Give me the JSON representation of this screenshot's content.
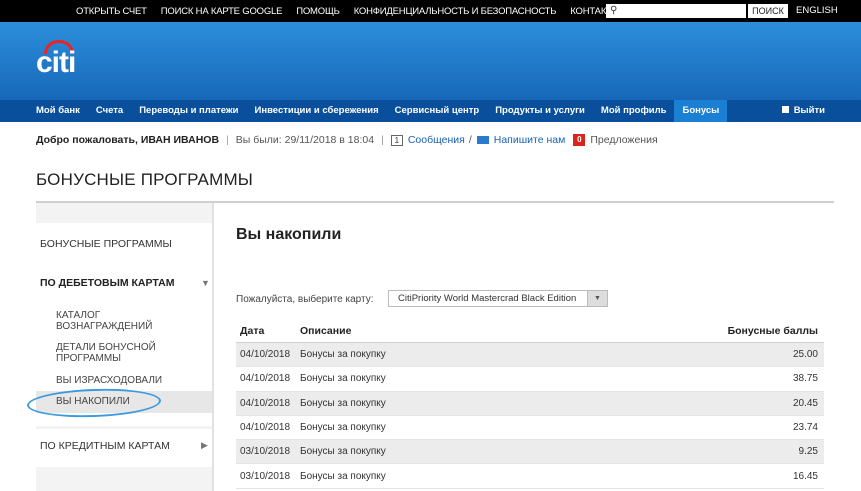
{
  "topbar": {
    "links": [
      "ОТКРЫТЬ СЧЕТ",
      "ПОИСК НА КАРТЕ GOOGLE",
      "ПОМОЩЬ",
      "КОНФИДЕНЦИАЛЬНОСТЬ И БЕЗОПАСНОСТЬ",
      "КОНТАКТЫ"
    ],
    "search_value": "",
    "search_button": "ПОИСК",
    "language": "ENGLISH"
  },
  "logo": {
    "text": "citi",
    "arc_color": "#e22222"
  },
  "nav": {
    "items": [
      "Мой банк",
      "Счета",
      "Переводы и платежи",
      "Инвестиции и сбережения",
      "Сервисный центр",
      "Продукты и услуги",
      "Мой профиль",
      "Бонусы"
    ],
    "active": "Бонусы",
    "logout": "Выйти"
  },
  "welcome": {
    "greeting": "Добро пожаловать, ИВАН ИВАНОВ",
    "separator": "|",
    "last_visit": "Вы были: 29/11/2018 в 18:04",
    "messages_count": "1",
    "messages": "Сообщения",
    "slash": "/",
    "write_us": "Напишите нам",
    "offers_count": "0",
    "offers": "Предложения"
  },
  "page": {
    "title": "БОНУСНЫЕ ПРОГРАММЫ"
  },
  "sidebar": {
    "programs": "БОНУСНЫЕ ПРОГРАММЫ",
    "debit": "ПО ДЕБЕТОВЫМ КАРТАМ",
    "sub": [
      "КАТАЛОГ ВОЗНАГРАЖДЕНИЙ",
      "ДЕТАЛИ БОНУСНОЙ ПРОГРАММЫ",
      "ВЫ ИЗРАСХОДОВАЛИ",
      "ВЫ НАКОПИЛИ"
    ],
    "credit": "ПО КРЕДИТНЫМ КАРТАМ"
  },
  "content": {
    "title": "Вы накопили",
    "select_label": "Пожалуйста, выберите карту:",
    "select_value": "CitiPriority World Mastercrad Black Edition",
    "columns": [
      "Дата",
      "Описание",
      "Бонусные баллы"
    ],
    "rows": [
      [
        "04/10/2018",
        "Бонусы за покупку",
        "25.00"
      ],
      [
        "04/10/2018",
        "Бонусы за покупку",
        "38.75"
      ],
      [
        "04/10/2018",
        "Бонусы за покупку",
        "20.45"
      ],
      [
        "04/10/2018",
        "Бонусы за покупку",
        "23.74"
      ],
      [
        "03/10/2018",
        "Бонусы за покупку",
        "9.25"
      ],
      [
        "03/10/2018",
        "Бонусы за покупку",
        "16.45"
      ]
    ]
  },
  "colors": {
    "header_blue": "#1b74c8",
    "nav_blue": "#0a4f9c",
    "active_tab": "#1b7fd4",
    "circle": "#3e9ae0"
  }
}
